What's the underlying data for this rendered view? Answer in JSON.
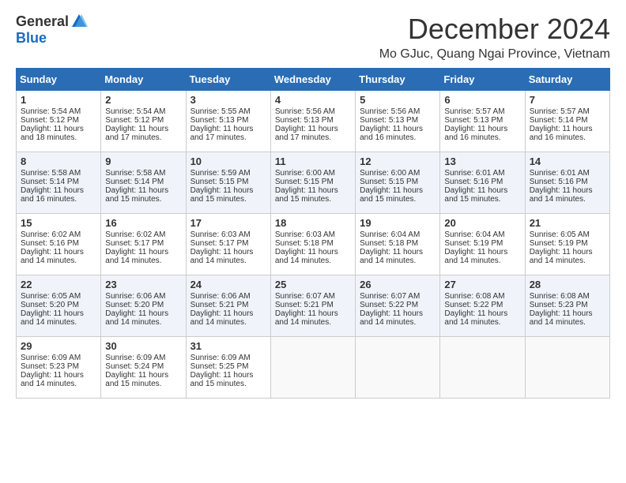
{
  "logo": {
    "general": "General",
    "blue": "Blue"
  },
  "title": {
    "month": "December 2024",
    "location": "Mo GJuc, Quang Ngai Province, Vietnam"
  },
  "headers": [
    "Sunday",
    "Monday",
    "Tuesday",
    "Wednesday",
    "Thursday",
    "Friday",
    "Saturday"
  ],
  "weeks": [
    [
      {
        "day": "1",
        "sunrise": "5:54 AM",
        "sunset": "5:12 PM",
        "daylight": "11 hours and 18 minutes."
      },
      {
        "day": "2",
        "sunrise": "5:54 AM",
        "sunset": "5:12 PM",
        "daylight": "11 hours and 17 minutes."
      },
      {
        "day": "3",
        "sunrise": "5:55 AM",
        "sunset": "5:13 PM",
        "daylight": "11 hours and 17 minutes."
      },
      {
        "day": "4",
        "sunrise": "5:56 AM",
        "sunset": "5:13 PM",
        "daylight": "11 hours and 17 minutes."
      },
      {
        "day": "5",
        "sunrise": "5:56 AM",
        "sunset": "5:13 PM",
        "daylight": "11 hours and 16 minutes."
      },
      {
        "day": "6",
        "sunrise": "5:57 AM",
        "sunset": "5:13 PM",
        "daylight": "11 hours and 16 minutes."
      },
      {
        "day": "7",
        "sunrise": "5:57 AM",
        "sunset": "5:14 PM",
        "daylight": "11 hours and 16 minutes."
      }
    ],
    [
      {
        "day": "8",
        "sunrise": "5:58 AM",
        "sunset": "5:14 PM",
        "daylight": "11 hours and 16 minutes."
      },
      {
        "day": "9",
        "sunrise": "5:58 AM",
        "sunset": "5:14 PM",
        "daylight": "11 hours and 15 minutes."
      },
      {
        "day": "10",
        "sunrise": "5:59 AM",
        "sunset": "5:15 PM",
        "daylight": "11 hours and 15 minutes."
      },
      {
        "day": "11",
        "sunrise": "6:00 AM",
        "sunset": "5:15 PM",
        "daylight": "11 hours and 15 minutes."
      },
      {
        "day": "12",
        "sunrise": "6:00 AM",
        "sunset": "5:15 PM",
        "daylight": "11 hours and 15 minutes."
      },
      {
        "day": "13",
        "sunrise": "6:01 AM",
        "sunset": "5:16 PM",
        "daylight": "11 hours and 15 minutes."
      },
      {
        "day": "14",
        "sunrise": "6:01 AM",
        "sunset": "5:16 PM",
        "daylight": "11 hours and 14 minutes."
      }
    ],
    [
      {
        "day": "15",
        "sunrise": "6:02 AM",
        "sunset": "5:16 PM",
        "daylight": "11 hours and 14 minutes."
      },
      {
        "day": "16",
        "sunrise": "6:02 AM",
        "sunset": "5:17 PM",
        "daylight": "11 hours and 14 minutes."
      },
      {
        "day": "17",
        "sunrise": "6:03 AM",
        "sunset": "5:17 PM",
        "daylight": "11 hours and 14 minutes."
      },
      {
        "day": "18",
        "sunrise": "6:03 AM",
        "sunset": "5:18 PM",
        "daylight": "11 hours and 14 minutes."
      },
      {
        "day": "19",
        "sunrise": "6:04 AM",
        "sunset": "5:18 PM",
        "daylight": "11 hours and 14 minutes."
      },
      {
        "day": "20",
        "sunrise": "6:04 AM",
        "sunset": "5:19 PM",
        "daylight": "11 hours and 14 minutes."
      },
      {
        "day": "21",
        "sunrise": "6:05 AM",
        "sunset": "5:19 PM",
        "daylight": "11 hours and 14 minutes."
      }
    ],
    [
      {
        "day": "22",
        "sunrise": "6:05 AM",
        "sunset": "5:20 PM",
        "daylight": "11 hours and 14 minutes."
      },
      {
        "day": "23",
        "sunrise": "6:06 AM",
        "sunset": "5:20 PM",
        "daylight": "11 hours and 14 minutes."
      },
      {
        "day": "24",
        "sunrise": "6:06 AM",
        "sunset": "5:21 PM",
        "daylight": "11 hours and 14 minutes."
      },
      {
        "day": "25",
        "sunrise": "6:07 AM",
        "sunset": "5:21 PM",
        "daylight": "11 hours and 14 minutes."
      },
      {
        "day": "26",
        "sunrise": "6:07 AM",
        "sunset": "5:22 PM",
        "daylight": "11 hours and 14 minutes."
      },
      {
        "day": "27",
        "sunrise": "6:08 AM",
        "sunset": "5:22 PM",
        "daylight": "11 hours and 14 minutes."
      },
      {
        "day": "28",
        "sunrise": "6:08 AM",
        "sunset": "5:23 PM",
        "daylight": "11 hours and 14 minutes."
      }
    ],
    [
      {
        "day": "29",
        "sunrise": "6:09 AM",
        "sunset": "5:23 PM",
        "daylight": "11 hours and 14 minutes."
      },
      {
        "day": "30",
        "sunrise": "6:09 AM",
        "sunset": "5:24 PM",
        "daylight": "11 hours and 15 minutes."
      },
      {
        "day": "31",
        "sunrise": "6:09 AM",
        "sunset": "5:25 PM",
        "daylight": "11 hours and 15 minutes."
      },
      null,
      null,
      null,
      null
    ]
  ],
  "labels": {
    "sunrise": "Sunrise: ",
    "sunset": "Sunset: ",
    "daylight": "Daylight: "
  }
}
